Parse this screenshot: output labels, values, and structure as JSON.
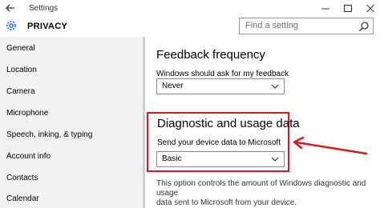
{
  "window": {
    "title": "Settings",
    "accent_color": "#d81c1c"
  },
  "header": {
    "title": "PRIVACY",
    "search_placeholder": "Find a setting"
  },
  "sidebar": {
    "items": [
      {
        "label": "General"
      },
      {
        "label": "Location"
      },
      {
        "label": "Camera"
      },
      {
        "label": "Microphone"
      },
      {
        "label": "Speech, inking, & typing"
      },
      {
        "label": "Account info"
      },
      {
        "label": "Contacts"
      },
      {
        "label": "Calendar"
      }
    ]
  },
  "main": {
    "feedback": {
      "heading": "Feedback frequency",
      "label": "Windows should ask for my feedback",
      "selected": "Never"
    },
    "diagnostic": {
      "heading": "Diagnostic and usage data",
      "label": "Send your device data to Microsoft",
      "selected": "Basic",
      "description_line1": "This option controls the amount of Windows diagnostic and usage",
      "description_line2": "data sent to Microsoft from your device."
    }
  },
  "icons": {
    "back": "back-arrow-icon",
    "settings": "gear-icon",
    "search": "search-icon",
    "dropdown": "chevron-down-icon",
    "annotation": "red-arrow-icon"
  }
}
